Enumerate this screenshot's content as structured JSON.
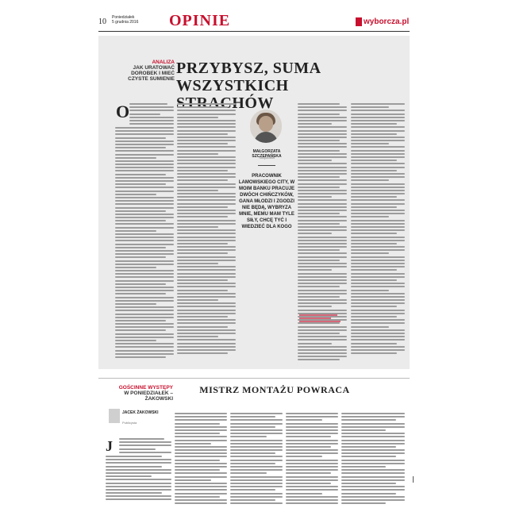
{
  "header": {
    "page_number": "10",
    "day": "Poniedziałek",
    "date": "5 grudnia 2016",
    "section": "OPINIE",
    "logo": "wyborcza.pl",
    "brand_color": "#c8102e"
  },
  "main_article": {
    "kicker_label": "ANALIZA",
    "kicker_text": "JAK URATOWAĆ DOROBEK I MIEĆ CZYSTE SUMIENIE",
    "headline_line1": "PRZYBYSZ, SUMA",
    "headline_line2": "WSZYSTKICH STRACHÓW",
    "dropcap": "O",
    "author": "MAŁGORZATA SZCZEPAŃSKA",
    "author_role": "Socjolożka",
    "pullquote": "PRACOWNIK LAMOWSKIEGO CITY, W MOIM BANKU PRACUJE DWÓCH CHIŃCZYKÓW, GANA MŁODZI I ZGODZI NIE BĘDĄ, WYBRYZA MNIE, MEMU MAM TYLE SIŁY, CHCĘ TYĆ I WIEDZIEĆ DLA KOGO"
  },
  "bottom_article": {
    "kicker_line1": "GOŚCINNE WYSTĘPY",
    "kicker_line2": "W PONIEDZIAŁEK – ŻAKOWSKI",
    "headline": "MISTRZ MONTAŻU POWRACA",
    "author": "JACEK ŻAKOWSKI",
    "author_role": "Publicysta",
    "dropcap": "J"
  }
}
